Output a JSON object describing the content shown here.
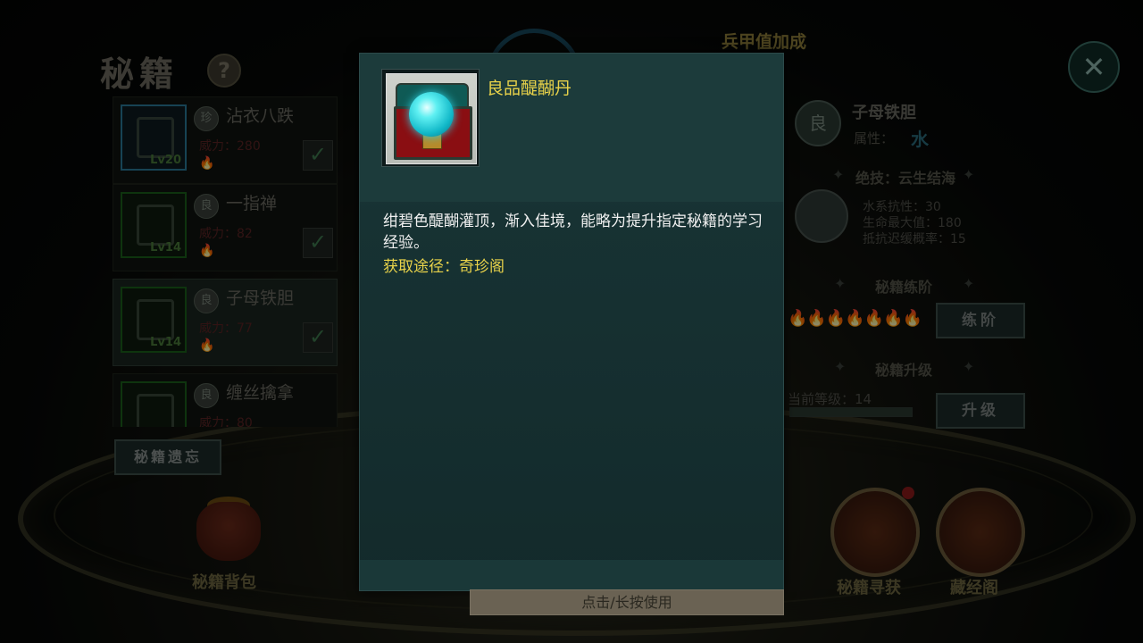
{
  "background": {
    "panel_title": "秘籍",
    "help_icon": "question-icon",
    "close_icon": "close-x-icon",
    "top_bonus_title": "兵甲值加成",
    "book_list": [
      {
        "name": "沾衣八跌",
        "rank": "珍",
        "power": "威力：280",
        "level": "Lv20",
        "equipped": true
      },
      {
        "name": "一指禅",
        "rank": "良",
        "power": "威力：82",
        "level": "Lv14",
        "equipped": true
      },
      {
        "name": "子母铁胆",
        "rank": "良",
        "power": "威力：77",
        "level": "Lv14",
        "equipped": true
      },
      {
        "name": "缠丝擒拿",
        "rank": "良",
        "power": "威力：80",
        "level": "",
        "equipped": false
      }
    ],
    "forget_button": "秘籍遗忘",
    "bottom_buttons": [
      {
        "label": "秘籍背包",
        "icon": "treasure-bag-icon"
      },
      {
        "label": "秘籍寻获",
        "icon": "scroll-search-icon"
      },
      {
        "label": "藏经阁",
        "icon": "library-icon"
      }
    ],
    "detail": {
      "rank": "良",
      "name": "子母铁胆",
      "attribute_label": "属性：",
      "attribute_value": "水",
      "skill_title": "绝技：云生结海",
      "stats": [
        "水系抗性：30",
        "生命最大值：180",
        "抵抗迟缓概率：15"
      ],
      "practice_title": "秘籍练阶",
      "practice_button": "练阶",
      "practice_lit": 1,
      "practice_total": 7,
      "upgrade_title": "秘籍升级",
      "current_level": "当前等级：14",
      "upgrade_button": "升级"
    }
  },
  "dialog": {
    "item_name": "良品醍醐丹",
    "item_icon": "jade-pearl-chest-icon",
    "description": "绀碧色醍醐灌顶，渐入佳境，能略为提升指定秘籍的学习经验。",
    "source": "获取途径：奇珍阁",
    "use_button": "点击/长按使用"
  },
  "colors": {
    "dialog_bg": "#173233",
    "item_name": "#e8d24a",
    "source_text": "#e8d24a",
    "desc_text": "#f0f0f0",
    "use_bar": "#6a6253"
  }
}
